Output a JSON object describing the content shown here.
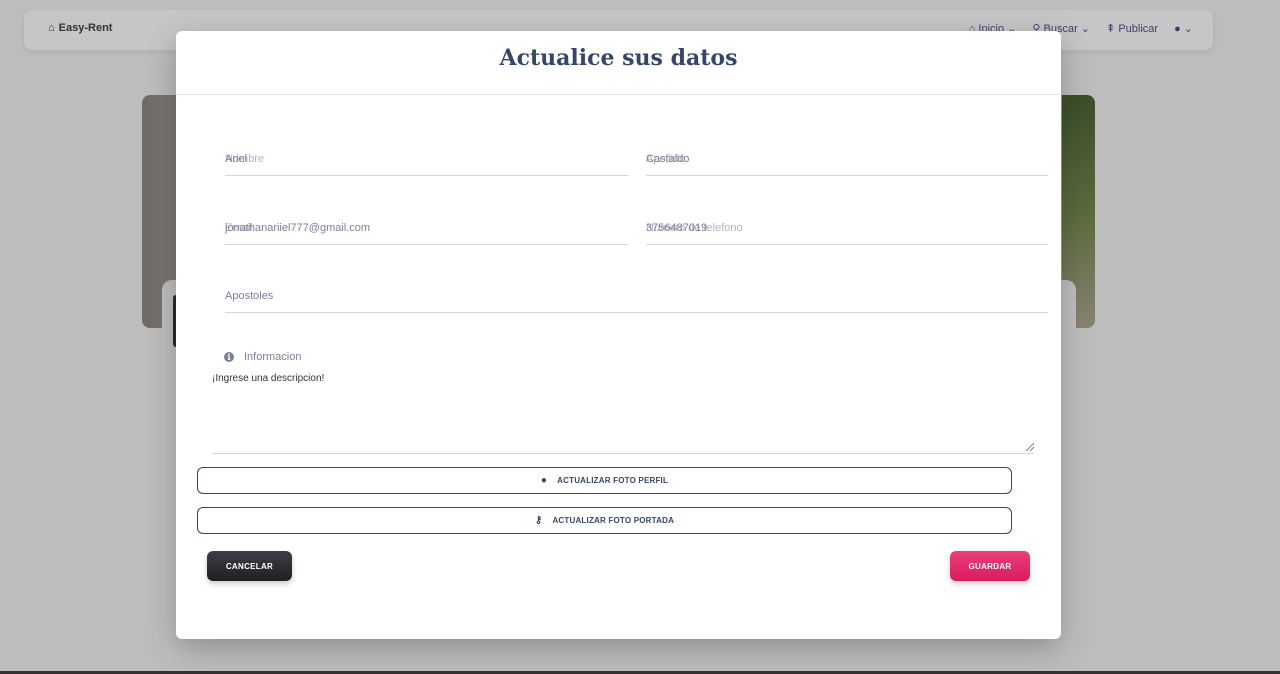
{
  "navbar": {
    "brand": "Easy-Rent",
    "brand_icon": "home-outline-icon",
    "links": [
      {
        "label": "Inicio",
        "icon": "home-icon"
      },
      {
        "label": "Buscar",
        "icon": "search-icon"
      },
      {
        "label": "Publicar",
        "icon": "upload-icon"
      }
    ],
    "user_icon": "user-icon"
  },
  "modal": {
    "title": "Actualice sus datos",
    "fields": {
      "nombre": {
        "value": "Ariel",
        "placeholder": "Nombre"
      },
      "apellido": {
        "value": "Castaldo",
        "placeholder": "Apellido"
      },
      "email": {
        "value": "jonathanariiel777@gmail.com",
        "placeholder": "Email"
      },
      "telefono": {
        "value": "3756487019",
        "placeholder": "Numero de telefono"
      },
      "ciudad": {
        "value": "Apostoles"
      }
    },
    "info": {
      "label": "Informacion",
      "icon": "info-icon",
      "value": "¡Ingrese una descripcion!"
    },
    "buttons": {
      "foto_perfil": "ACTUALIZAR FOTO PERFIL",
      "foto_portada": "ACTUALIZAR FOTO PORTADA",
      "cancelar": "CANCELAR",
      "guardar": "GUARDAR"
    }
  },
  "colors": {
    "title": "#344767",
    "primary_pink": "#e91e63",
    "dark_button": "#202020",
    "overlay": "#bdbdbd"
  }
}
